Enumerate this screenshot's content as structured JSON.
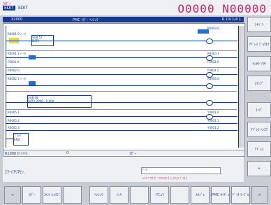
{
  "header": {
    "mode_top": "ﾗﾀﾞｰ",
    "mode_tag": "EDIT",
    "mode_sub": "EDIT",
    "program": "O0000 N00000"
  },
  "titlebar": {
    "left": "PMC ﾗﾀﾞｰ ﾍﾝｼｭｳ",
    "center": "X2000",
    "right": "R 1/4 1/4 1"
  },
  "ladder": {
    "rungs": [
      {
        "left_label": "R0001.0 ﾃﾞｰﾀ",
        "right_label": "R0003.0"
      },
      {
        "left_label": "R0001.1 ﾃﾞｰﾀ",
        "right_label": "R0003.1"
      },
      {
        "left_label": "F0001.0",
        "right_label": "F0003.0"
      },
      {
        "left_label": "R0002.0",
        "right_label": "F0003.1"
      },
      {
        "left_label": "R0002.1 ﾃﾞｰﾀ",
        "right_label": "R0005.0"
      },
      {
        "left_label": "R0005.1",
        "right_label": "Y0001.0"
      },
      {
        "left_label": "R0005.2",
        "right_label": "Y0001.1"
      },
      {
        "left_label": "R0005.3",
        "right_label": "Y0001.2"
      }
    ],
    "func_block_1": {
      "line1": "SUB 57 ",
      "line2": "DATA"
    },
    "func_block_2": {
      "line1": "SUB 08",
      "line2": "DATA  2000  -  0.000"
    },
    "func_block_3": {
      "line1": "ﾌﾞﾛｯｸ",
      "line2": "END"
    }
  },
  "status": {
    "left": "R1000 0 ﾌｧｲﾙ",
    "center": "0",
    "right": "ﾗﾀﾞｰ"
  },
  "message": {
    "text": "ｴﾗｰﾊｱﾘﾏｾﾝ.",
    "input_value": "ﾃﾞｰﾀ",
    "hint": "ｼﾝｺﾞｳ ｻﾁ ｶﾞ ﾐﾂｶﾘﾏｾﾝ [ ｼｭｳﾘｮｳ ﾂﾞｲｶ ]"
  },
  "right_keys": [
    {
      "label": "ｼｷﾍﾞﾂ"
    },
    {
      "label": "ｱﾄﾞﾚｽ ｼﾞｮｳﾎｳ"
    },
    {
      "label": "ｹﾝｻｸ ｿｳｻ"
    },
    {
      "label": "ｽﾃｯﾌﾟ"
    },
    {
      "label": "ﾗﾝｸﾞ"
    },
    {
      "label": "ｱﾄﾞﾚｽ ﾍﾝｺｳ"
    },
    {
      "label": "ｱﾄﾞﾚｽ"
    },
    {
      "label": "+"
    }
  ],
  "bottom_keys": [
    {
      "label": "ﾗﾀﾞｰ"
    },
    {
      "label": "ｺﾒﾝﾄ ﾋｮｳｼﾞ"
    },
    {
      "label": ""
    },
    {
      "label": "ﾍﾝｼｭｳ"
    },
    {
      "label": "ｼﾝｷ"
    },
    {
      "label": ""
    },
    {
      "label": "ｿｳﾆｭｳ"
    },
    {
      "label": ""
    },
    {
      "label": "ｶｲｼﾞｮ"
    },
    {
      "label": "PMC ｾｲｷﾞｮ"
    },
    {
      "label": "ﾃﾞｰﾀ ﾃｰﾌﾞﾙ"
    }
  ]
}
